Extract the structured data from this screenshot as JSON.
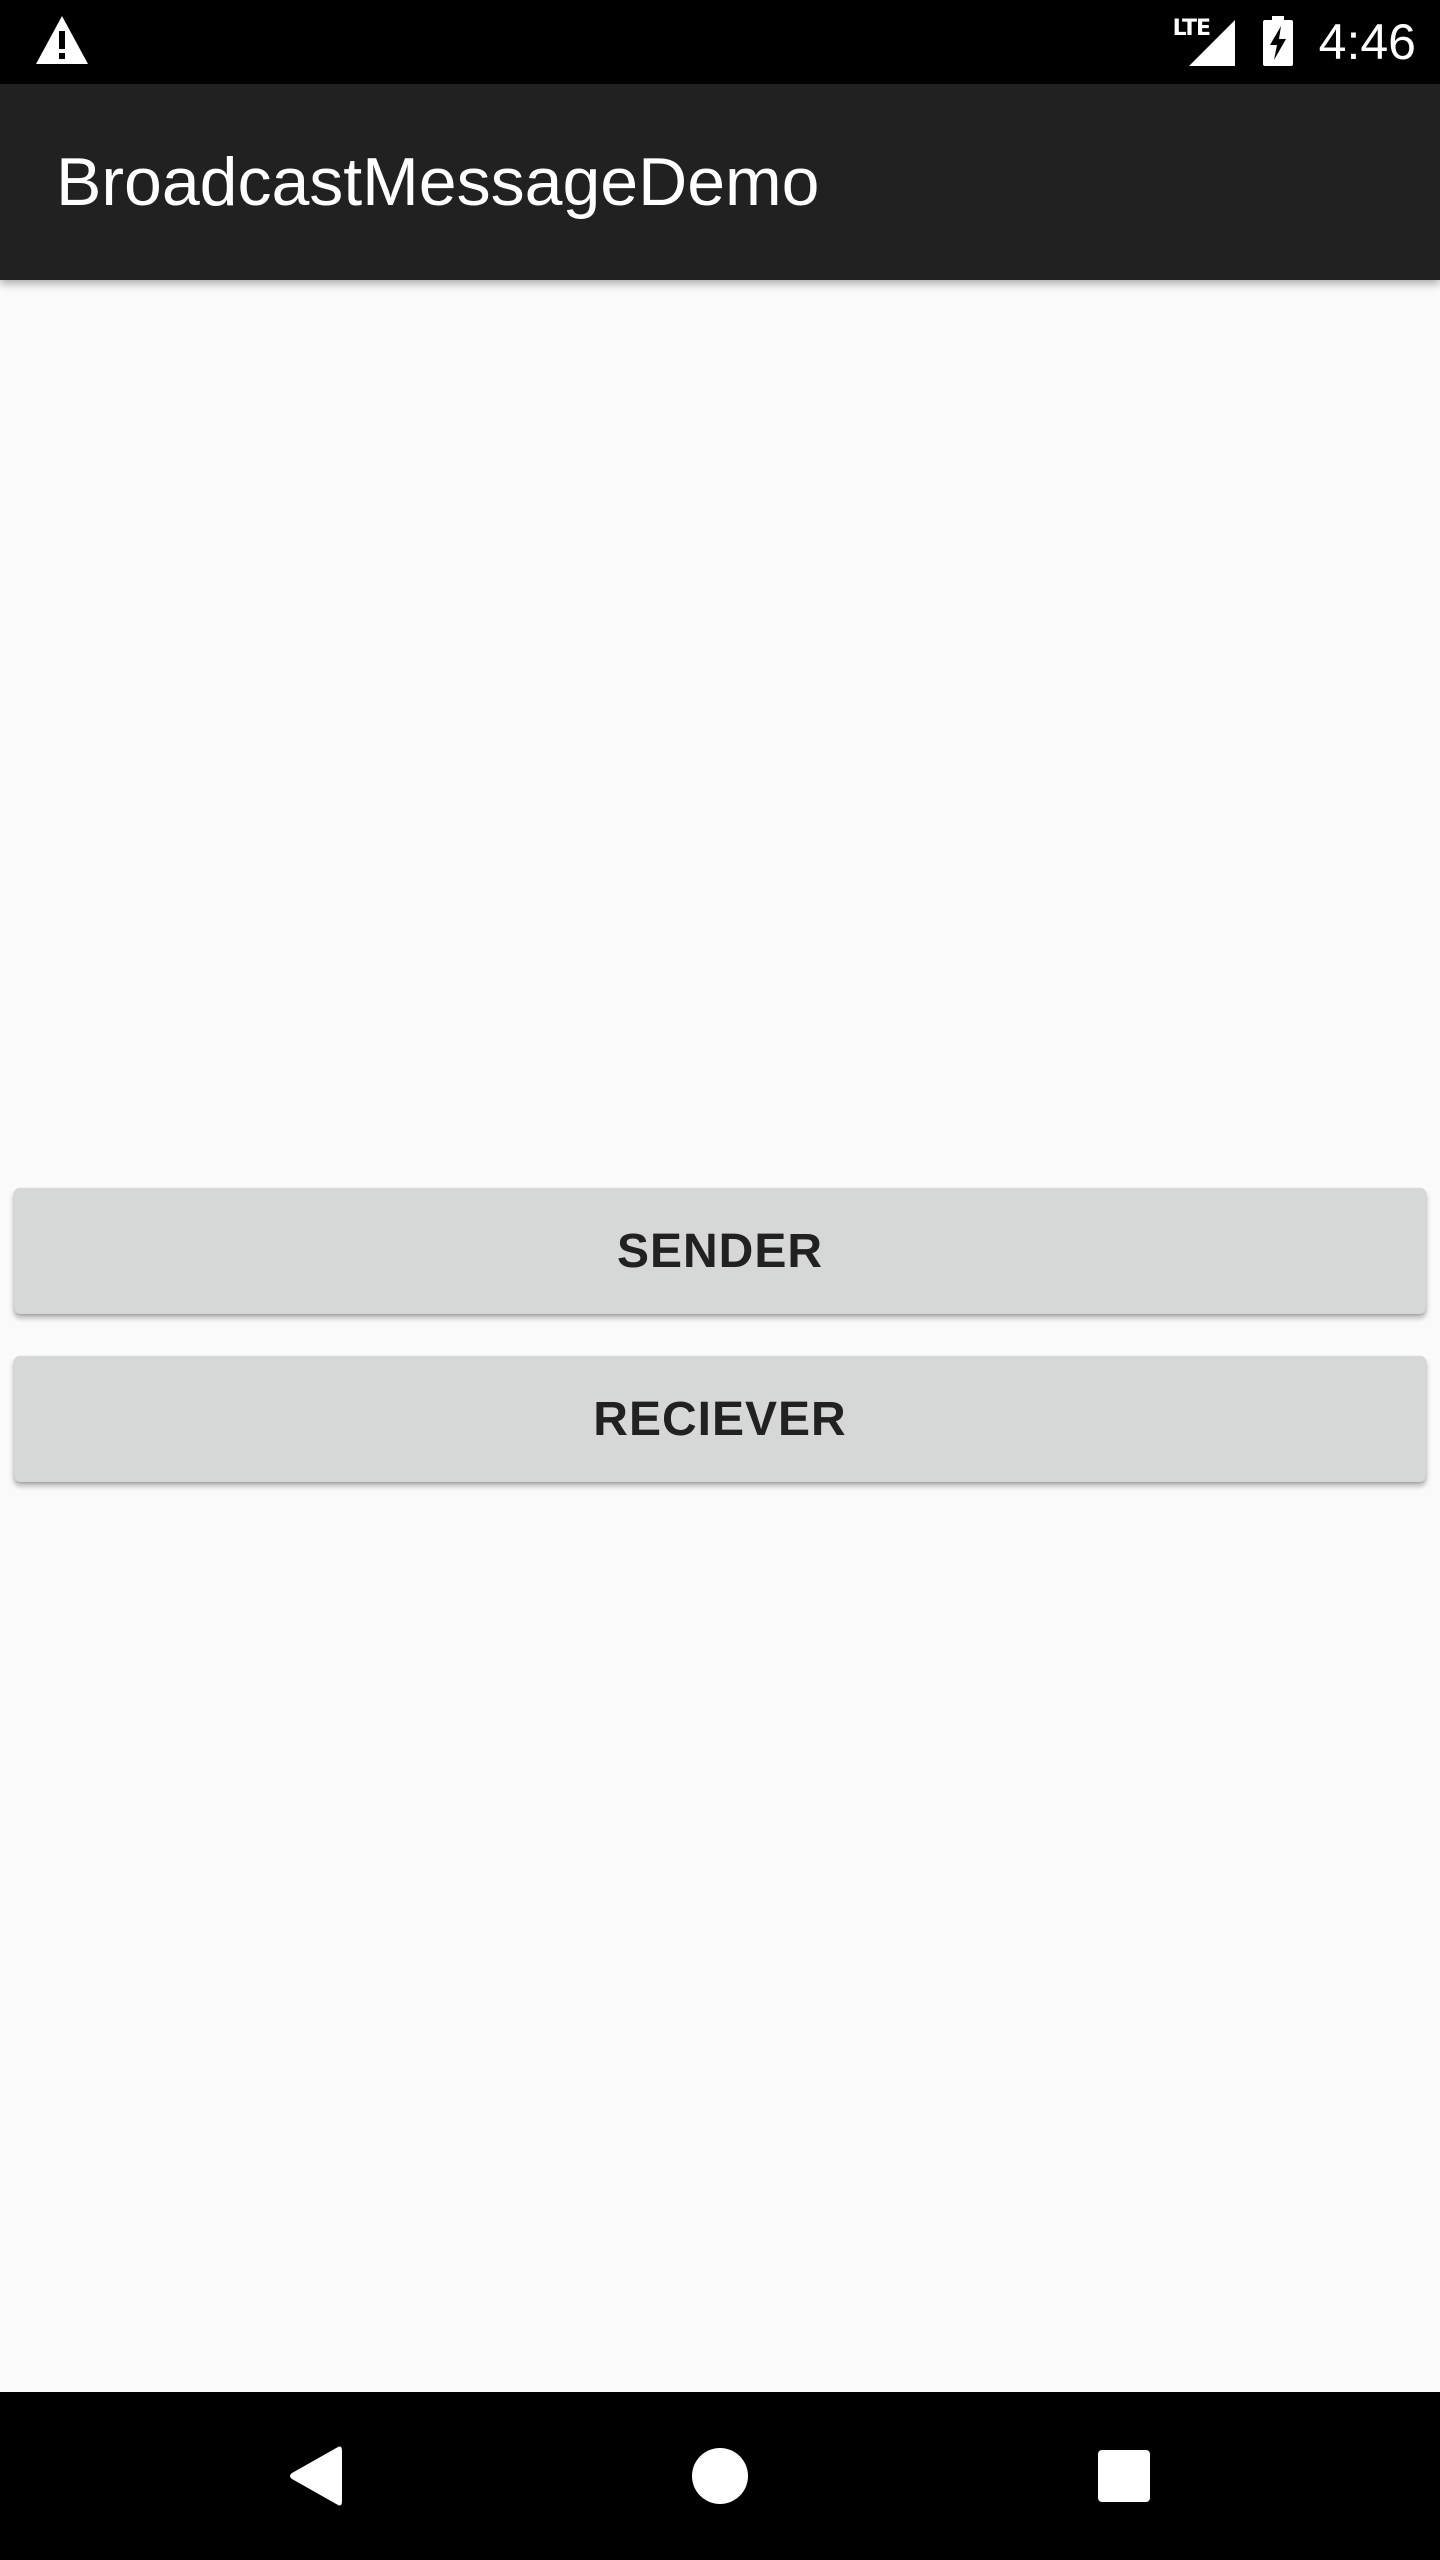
{
  "status_bar": {
    "time": "4:46",
    "network_label": "LTE",
    "icons": [
      "warning-icon",
      "lte-signal-icon",
      "battery-charging-icon"
    ]
  },
  "app_bar": {
    "title": "BroadcastMessageDemo"
  },
  "main": {
    "sender_label": "SENDER",
    "receiver_label": "RECIEVER"
  },
  "nav_bar": {
    "icons": [
      "back-icon",
      "home-icon",
      "recents-icon"
    ]
  },
  "colors": {
    "status_bar": "#000000",
    "app_bar": "#212121",
    "background": "#fafafa",
    "button": "#d6d7d7",
    "button_text": "#212121",
    "nav_bar": "#000000"
  }
}
